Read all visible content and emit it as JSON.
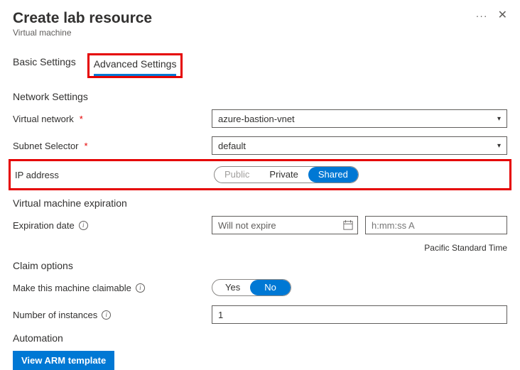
{
  "header": {
    "title": "Create lab resource",
    "subtitle": "Virtual machine"
  },
  "tabs": {
    "basic": "Basic Settings",
    "advanced": "Advanced Settings"
  },
  "network": {
    "title": "Network Settings",
    "vnet_label": "Virtual network",
    "vnet_value": "azure-bastion-vnet",
    "subnet_label": "Subnet Selector",
    "subnet_value": "default",
    "ip_label": "IP address",
    "ip_options": {
      "public": "Public",
      "private": "Private",
      "shared": "Shared"
    }
  },
  "expiration": {
    "title": "Virtual machine expiration",
    "date_label": "Expiration date",
    "date_value": "Will not expire",
    "time_placeholder": "h:mm:ss A",
    "timezone": "Pacific Standard Time"
  },
  "claim": {
    "title": "Claim options",
    "claimable_label": "Make this machine claimable",
    "yes": "Yes",
    "no": "No",
    "instances_label": "Number of instances",
    "instances_value": "1"
  },
  "automation": {
    "title": "Automation",
    "view_template": "View ARM template"
  }
}
